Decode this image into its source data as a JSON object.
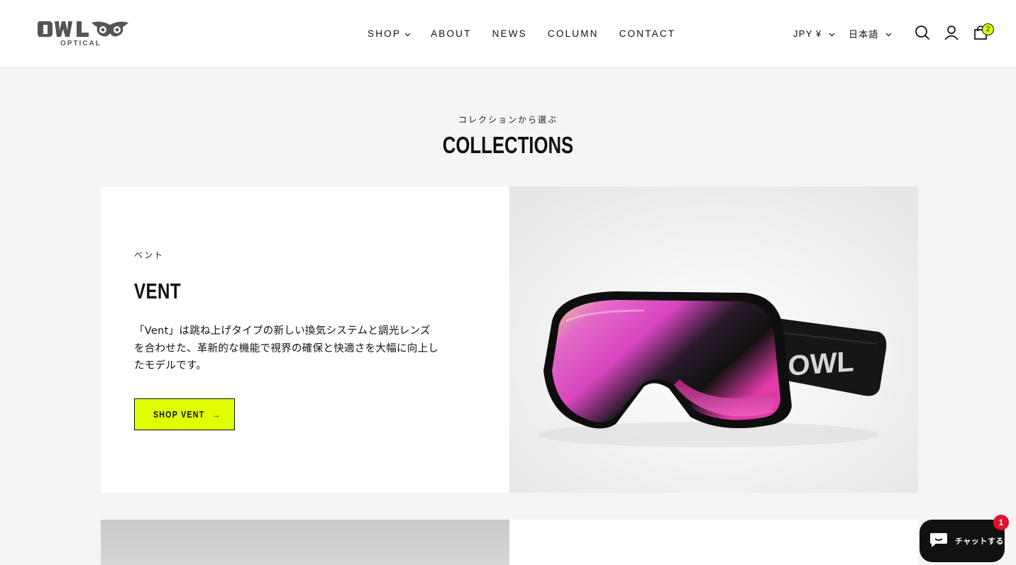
{
  "brand": {
    "name": "OWL",
    "tagline": "OPTICAL"
  },
  "nav": {
    "items": [
      {
        "label": "SHOP",
        "has_dropdown": true
      },
      {
        "label": "ABOUT"
      },
      {
        "label": "NEWS"
      },
      {
        "label": "COLUMN"
      },
      {
        "label": "CONTACT"
      }
    ]
  },
  "header": {
    "currency": "JPY ¥",
    "language": "日本語",
    "cart_count": "2",
    "icons": [
      "search-icon",
      "account-icon",
      "cart-icon"
    ]
  },
  "section": {
    "subheading": "コレクションから選ぶ",
    "heading": "COLLECTIONS"
  },
  "collections": [
    {
      "subtitle": "ベント",
      "title": "VENT",
      "description": "「Vent」は跳ね上げタイプの新しい換気システムと調光レンズを合わせた、革新的な機能で視界の確保と快適さを大幅に向上したモデルです。",
      "button_label": "SHOP VENT",
      "button_arrow": "→",
      "image_strap_text": "OWL"
    }
  ],
  "chat": {
    "label": "チャットする",
    "badge": "1"
  },
  "colors": {
    "accent": "#e0ff00",
    "background": "#f5f5f5",
    "text": "#111111",
    "chat_bg": "#111111",
    "badge_red": "#e0112b"
  }
}
